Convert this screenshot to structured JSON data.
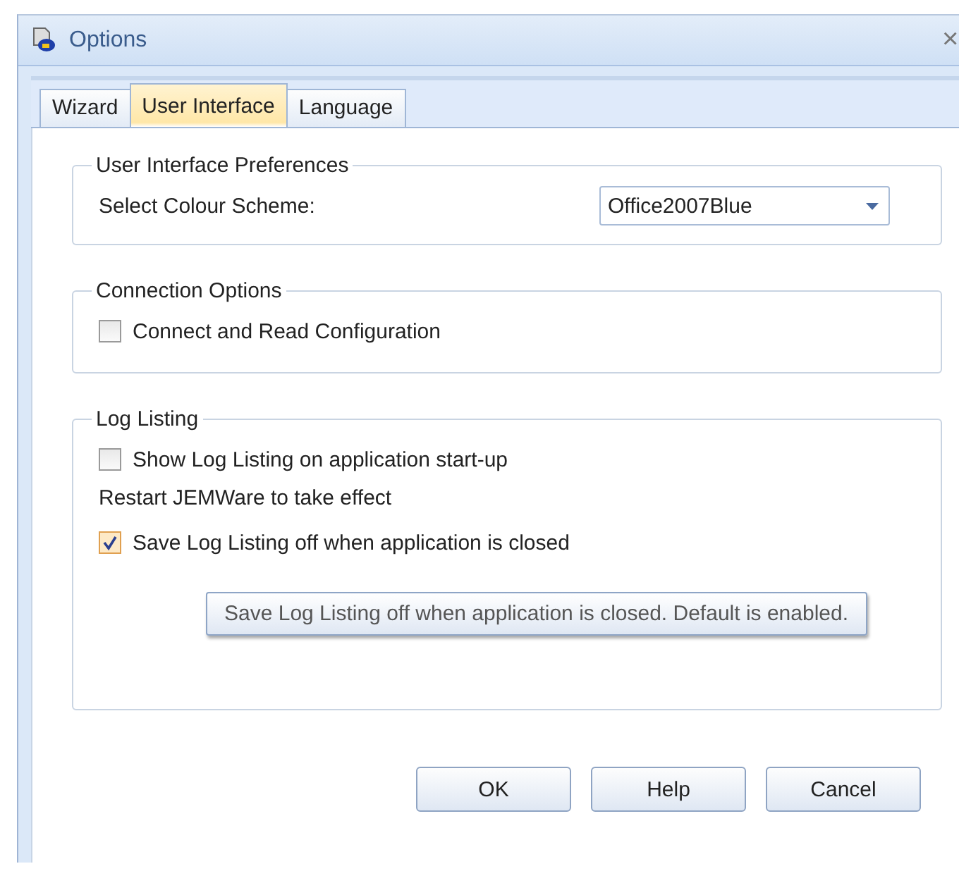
{
  "window": {
    "title": "Options",
    "close": "×"
  },
  "tabs": [
    {
      "label": "Wizard",
      "selected": false
    },
    {
      "label": "User Interface",
      "selected": true
    },
    {
      "label": "Language",
      "selected": false
    }
  ],
  "groups": [
    {
      "title": "User Interface Preferences",
      "items": [
        {
          "kind": "select",
          "label": "Select Colour Scheme:",
          "value": "Office2007Blue"
        }
      ]
    },
    {
      "title": "Connection Options",
      "items": [
        {
          "kind": "checkbox",
          "label": "Connect and Read Configuration",
          "checked": false
        }
      ]
    },
    {
      "title": "Log Listing",
      "items": [
        {
          "kind": "checkbox",
          "label": "Show Log Listing on application start-up",
          "checked": false
        },
        {
          "kind": "note",
          "label": "Restart JEMWare to take effect"
        },
        {
          "kind": "checkbox",
          "label": "Save Log Listing off when application is closed",
          "checked": true
        }
      ]
    }
  ],
  "tooltip": "Save Log Listing off when application is closed. Default is enabled.",
  "buttons": [
    "OK",
    "Help",
    "Cancel"
  ]
}
